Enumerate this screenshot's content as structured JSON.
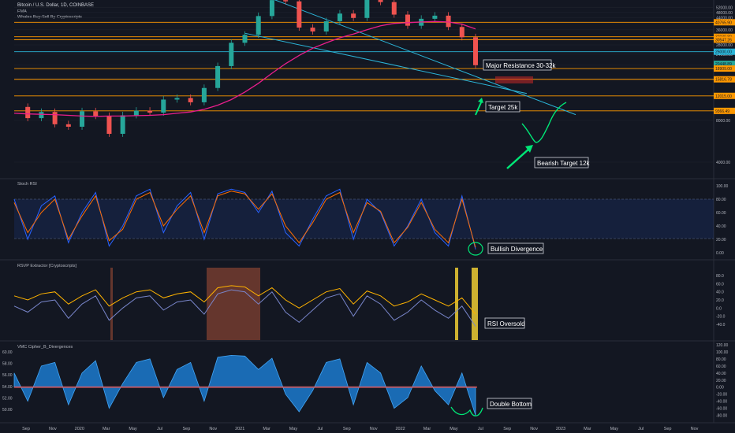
{
  "header": {
    "symbol": "Bitcoin / U.S. Dollar, 1D, COINBASE",
    "indicator_1": "EMA",
    "indicator_2": "Whales Buy-Sell By Cryptoscripts"
  },
  "panels": {
    "stoch_title": "Stoch RSI",
    "rsvp_title": "RSVP Extractor [Cryptoscripts]",
    "vmc_title": "VMC Cipher_B_Divergences"
  },
  "annotations": {
    "major_resistance": "Major Resistance 30-32k",
    "target_25k": "Target 25k",
    "bearish_target": "Bearish Target 12k",
    "bullish_divergence": "Bullish Divergence",
    "rsi_oversold": "RSI Oversold",
    "double_bottom": "Double Bottom"
  },
  "colors": {
    "background": "#131722",
    "grid": "#1e222d",
    "orange_level": "#ff9800",
    "trendline": "#2bb5d8",
    "ema": "#e91e8c",
    "bull_candle": "#26a69a",
    "bear_candle": "#ef5350",
    "stoch_k": "#2962ff",
    "stoch_d": "#ff6d00",
    "annotation_green": "#00e676"
  },
  "chart_data": [
    {
      "type": "line",
      "name": "main-price",
      "title": "Bitcoin / U.S. Dollar, 1D, COINBASE",
      "yscale": "log",
      "yaxis_ticks": [
        "52000.00",
        "48000.00",
        "44000.00",
        "40000.00",
        "36000.00",
        "32000.00",
        "28000.00",
        "24000.00",
        "20000.00",
        "16000.00",
        "12000.00",
        "8000.00",
        "4000.00"
      ],
      "price_labels": [
        "40765.90",
        "32039.89",
        "30547.26",
        "25000.00",
        "20448.89",
        "18909.00",
        "15816.78",
        "12015.00",
        "9366.49"
      ],
      "horizontal_levels": [
        40765.9,
        32039.89,
        30547.26,
        18909.0,
        15816.78,
        12015.0,
        9366.49
      ],
      "x": [
        "2019-08",
        "2019-09",
        "2019-10",
        "2019-11",
        "2019-12",
        "2020-01",
        "2020-02",
        "2020-03",
        "2020-04",
        "2020-05",
        "2020-06",
        "2020-07",
        "2020-08",
        "2020-09",
        "2020-10",
        "2020-11",
        "2020-12",
        "2021-01",
        "2021-02",
        "2021-03",
        "2021-04",
        "2021-05",
        "2021-06",
        "2021-07",
        "2021-08",
        "2021-09",
        "2021-10",
        "2021-11",
        "2021-12",
        "2022-01",
        "2022-02",
        "2022-03",
        "2022-04",
        "2022-05",
        "2022-06"
      ],
      "close": [
        10000,
        8300,
        9200,
        7500,
        7200,
        9300,
        8600,
        6400,
        8700,
        9400,
        9100,
        11300,
        11600,
        10800,
        13700,
        19700,
        29000,
        33100,
        45200,
        58900,
        57700,
        37300,
        35000,
        41500,
        47100,
        43800,
        61300,
        57000,
        46300,
        38500,
        43200,
        45500,
        37700,
        31800,
        20000
      ],
      "ema_200": [
        9000,
        8900,
        8850,
        8800,
        8700,
        8600,
        8550,
        8600,
        8600,
        8650,
        8700,
        8800,
        9000,
        9200,
        9600,
        10300,
        11300,
        12800,
        14800,
        17500,
        20500,
        23500,
        26500,
        29000,
        31500,
        33500,
        36000,
        38500,
        40000,
        40500,
        41000,
        41300,
        41000,
        39500,
        36500
      ],
      "labels": [
        "Sell",
        "Buy",
        "Bearish",
        "Bullish"
      ]
    },
    {
      "type": "line",
      "name": "stoch-rsi",
      "title": "Stoch RSI",
      "ylim": [
        0,
        100
      ],
      "yaxis_ticks": [
        "100.00",
        "80.00",
        "60.00",
        "40.00",
        "20.00",
        "0.00"
      ],
      "series": [
        {
          "name": "K",
          "values": [
            80,
            20,
            70,
            85,
            15,
            60,
            90,
            10,
            40,
            85,
            95,
            30,
            70,
            90,
            20,
            88,
            95,
            90,
            60,
            92,
            30,
            10,
            50,
            85,
            95,
            20,
            80,
            60,
            10,
            40,
            80,
            30,
            10,
            85,
            5
          ]
        },
        {
          "name": "D",
          "values": [
            75,
            30,
            60,
            80,
            20,
            55,
            85,
            18,
            35,
            80,
            90,
            40,
            65,
            85,
            30,
            85,
            92,
            88,
            65,
            88,
            40,
            15,
            45,
            80,
            90,
            30,
            75,
            62,
            15,
            38,
            75,
            35,
            15,
            80,
            8
          ]
        }
      ]
    },
    {
      "type": "line",
      "name": "rsvp-extractor",
      "title": "RSVP Extractor [Cryptoscripts]",
      "yaxis_ticks": [
        "80.0",
        "60.0",
        "40.0",
        "20.0",
        "0.0",
        "-20.0",
        "-40.0"
      ],
      "series": [
        {
          "name": "A",
          "values": [
            5,
            -10,
            15,
            20,
            -25,
            10,
            30,
            -30,
            0,
            25,
            30,
            -5,
            15,
            20,
            -15,
            35,
            45,
            40,
            10,
            40,
            -10,
            -35,
            -5,
            25,
            35,
            -20,
            30,
            10,
            -30,
            -10,
            20,
            -5,
            -25,
            5,
            -45
          ]
        },
        {
          "name": "B",
          "values": [
            30,
            20,
            35,
            40,
            10,
            30,
            45,
            5,
            25,
            40,
            45,
            25,
            35,
            40,
            15,
            50,
            55,
            52,
            30,
            50,
            20,
            0,
            20,
            40,
            48,
            10,
            42,
            30,
            5,
            15,
            35,
            20,
            5,
            25,
            -15
          ]
        }
      ]
    },
    {
      "type": "area",
      "name": "vmc-cipher-b",
      "title": "VMC Cipher_B_Divergences",
      "yaxis_ticks": [
        "120.00",
        "100.00",
        "80.00",
        "60.00",
        "40.00",
        "20.00",
        "0.00",
        "-20.00",
        "-40.00",
        "-60.00",
        "-80.00"
      ],
      "left_axis_ticks": [
        "60.00",
        "58.00",
        "56.00",
        "54.00",
        "52.00",
        "50.00"
      ],
      "series": [
        {
          "name": "Wave",
          "values": [
            40,
            -40,
            60,
            70,
            -50,
            40,
            75,
            -60,
            10,
            70,
            80,
            -30,
            50,
            70,
            -40,
            85,
            90,
            88,
            50,
            82,
            -20,
            -70,
            -10,
            70,
            80,
            -50,
            70,
            40,
            -60,
            -30,
            60,
            -10,
            -50,
            40,
            -80
          ]
        }
      ]
    }
  ],
  "x_axis": {
    "labels": [
      "Sep",
      "Nov",
      "2020",
      "Mar",
      "May",
      "Jul",
      "Sep",
      "Nov",
      "2021",
      "Mar",
      "May",
      "Jul",
      "Sep",
      "Nov",
      "2022",
      "Mar",
      "May",
      "Jul",
      "Sep",
      "Nov",
      "2023",
      "Mar",
      "May",
      "Jul",
      "Sep",
      "Nov"
    ]
  }
}
